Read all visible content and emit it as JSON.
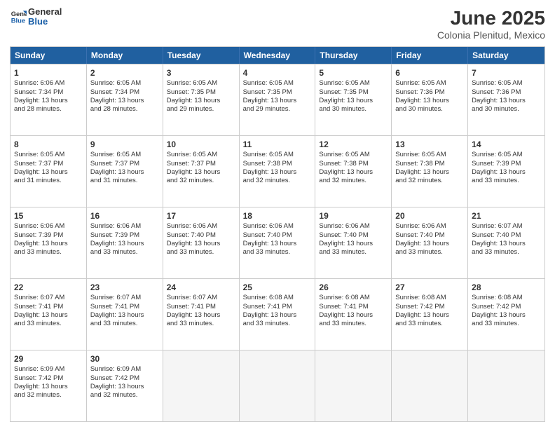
{
  "logo": {
    "line1": "General",
    "line2": "Blue"
  },
  "title": "June 2025",
  "subtitle": "Colonia Plenitud, Mexico",
  "header_days": [
    "Sunday",
    "Monday",
    "Tuesday",
    "Wednesday",
    "Thursday",
    "Friday",
    "Saturday"
  ],
  "rows": [
    [
      {
        "day": "1",
        "info": "Sunrise: 6:06 AM\nSunset: 7:34 PM\nDaylight: 13 hours\nand 28 minutes."
      },
      {
        "day": "2",
        "info": "Sunrise: 6:05 AM\nSunset: 7:34 PM\nDaylight: 13 hours\nand 28 minutes."
      },
      {
        "day": "3",
        "info": "Sunrise: 6:05 AM\nSunset: 7:35 PM\nDaylight: 13 hours\nand 29 minutes."
      },
      {
        "day": "4",
        "info": "Sunrise: 6:05 AM\nSunset: 7:35 PM\nDaylight: 13 hours\nand 29 minutes."
      },
      {
        "day": "5",
        "info": "Sunrise: 6:05 AM\nSunset: 7:35 PM\nDaylight: 13 hours\nand 30 minutes."
      },
      {
        "day": "6",
        "info": "Sunrise: 6:05 AM\nSunset: 7:36 PM\nDaylight: 13 hours\nand 30 minutes."
      },
      {
        "day": "7",
        "info": "Sunrise: 6:05 AM\nSunset: 7:36 PM\nDaylight: 13 hours\nand 30 minutes."
      }
    ],
    [
      {
        "day": "8",
        "info": "Sunrise: 6:05 AM\nSunset: 7:37 PM\nDaylight: 13 hours\nand 31 minutes."
      },
      {
        "day": "9",
        "info": "Sunrise: 6:05 AM\nSunset: 7:37 PM\nDaylight: 13 hours\nand 31 minutes."
      },
      {
        "day": "10",
        "info": "Sunrise: 6:05 AM\nSunset: 7:37 PM\nDaylight: 13 hours\nand 32 minutes."
      },
      {
        "day": "11",
        "info": "Sunrise: 6:05 AM\nSunset: 7:38 PM\nDaylight: 13 hours\nand 32 minutes."
      },
      {
        "day": "12",
        "info": "Sunrise: 6:05 AM\nSunset: 7:38 PM\nDaylight: 13 hours\nand 32 minutes."
      },
      {
        "day": "13",
        "info": "Sunrise: 6:05 AM\nSunset: 7:38 PM\nDaylight: 13 hours\nand 32 minutes."
      },
      {
        "day": "14",
        "info": "Sunrise: 6:05 AM\nSunset: 7:39 PM\nDaylight: 13 hours\nand 33 minutes."
      }
    ],
    [
      {
        "day": "15",
        "info": "Sunrise: 6:06 AM\nSunset: 7:39 PM\nDaylight: 13 hours\nand 33 minutes."
      },
      {
        "day": "16",
        "info": "Sunrise: 6:06 AM\nSunset: 7:39 PM\nDaylight: 13 hours\nand 33 minutes."
      },
      {
        "day": "17",
        "info": "Sunrise: 6:06 AM\nSunset: 7:40 PM\nDaylight: 13 hours\nand 33 minutes."
      },
      {
        "day": "18",
        "info": "Sunrise: 6:06 AM\nSunset: 7:40 PM\nDaylight: 13 hours\nand 33 minutes."
      },
      {
        "day": "19",
        "info": "Sunrise: 6:06 AM\nSunset: 7:40 PM\nDaylight: 13 hours\nand 33 minutes."
      },
      {
        "day": "20",
        "info": "Sunrise: 6:06 AM\nSunset: 7:40 PM\nDaylight: 13 hours\nand 33 minutes."
      },
      {
        "day": "21",
        "info": "Sunrise: 6:07 AM\nSunset: 7:40 PM\nDaylight: 13 hours\nand 33 minutes."
      }
    ],
    [
      {
        "day": "22",
        "info": "Sunrise: 6:07 AM\nSunset: 7:41 PM\nDaylight: 13 hours\nand 33 minutes."
      },
      {
        "day": "23",
        "info": "Sunrise: 6:07 AM\nSunset: 7:41 PM\nDaylight: 13 hours\nand 33 minutes."
      },
      {
        "day": "24",
        "info": "Sunrise: 6:07 AM\nSunset: 7:41 PM\nDaylight: 13 hours\nand 33 minutes."
      },
      {
        "day": "25",
        "info": "Sunrise: 6:08 AM\nSunset: 7:41 PM\nDaylight: 13 hours\nand 33 minutes."
      },
      {
        "day": "26",
        "info": "Sunrise: 6:08 AM\nSunset: 7:41 PM\nDaylight: 13 hours\nand 33 minutes."
      },
      {
        "day": "27",
        "info": "Sunrise: 6:08 AM\nSunset: 7:42 PM\nDaylight: 13 hours\nand 33 minutes."
      },
      {
        "day": "28",
        "info": "Sunrise: 6:08 AM\nSunset: 7:42 PM\nDaylight: 13 hours\nand 33 minutes."
      }
    ],
    [
      {
        "day": "29",
        "info": "Sunrise: 6:09 AM\nSunset: 7:42 PM\nDaylight: 13 hours\nand 32 minutes."
      },
      {
        "day": "30",
        "info": "Sunrise: 6:09 AM\nSunset: 7:42 PM\nDaylight: 13 hours\nand 32 minutes."
      },
      {
        "day": "",
        "info": ""
      },
      {
        "day": "",
        "info": ""
      },
      {
        "day": "",
        "info": ""
      },
      {
        "day": "",
        "info": ""
      },
      {
        "day": "",
        "info": ""
      }
    ]
  ]
}
